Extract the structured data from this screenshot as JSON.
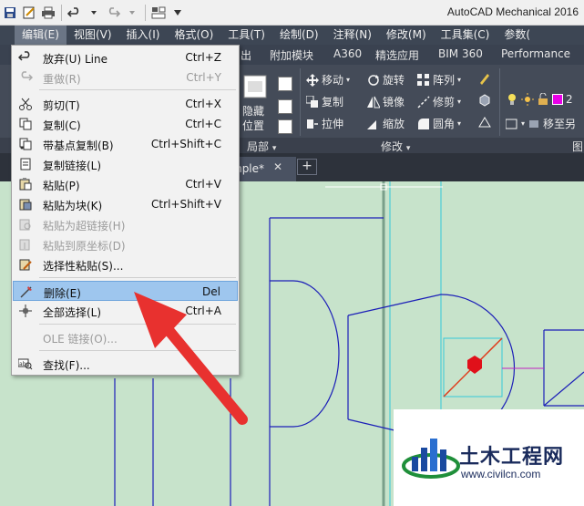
{
  "window": {
    "title": "AutoCAD Mechanical 2016"
  },
  "quick_access": {
    "icons": [
      "save-icon",
      "save-as-icon",
      "print-icon",
      "undo-icon",
      "redo-icon",
      "workspace-icon",
      "overflow-icon"
    ]
  },
  "menubar": {
    "items": [
      {
        "label": "编辑(E)",
        "active": true
      },
      {
        "label": "视图(V)"
      },
      {
        "label": "插入(I)"
      },
      {
        "label": "格式(O)"
      },
      {
        "label": "工具(T)"
      },
      {
        "label": "绘制(D)"
      },
      {
        "label": "注释(N)"
      },
      {
        "label": "修改(M)"
      },
      {
        "label": "工具集(C)"
      },
      {
        "label": "参数("
      }
    ]
  },
  "ribbon": {
    "tabs": [
      "出",
      "附加模块",
      "A360",
      "精选应用",
      "BIM 360",
      "Performance"
    ],
    "modify_tools": {
      "move": "移动",
      "rotate": "旋转",
      "array": "阵列",
      "copy": "复制",
      "mirror": "镜像",
      "trim": "修剪",
      "stretch": "拉伸",
      "scale": "缩放",
      "fillet": "圆角",
      "move_to_other": "移至另"
    },
    "local_tools": {
      "hide_label": "隐藏",
      "position_label": "位置"
    },
    "layer_value": "2",
    "panel_titles": {
      "local": "局部",
      "modify": "修改",
      "partial": "图"
    },
    "colors": {
      "layer_swatch": "#e800e8"
    }
  },
  "document": {
    "tab_label": "mple*",
    "close_glyph": "✕",
    "new_tab_glyph": "+"
  },
  "edit_menu": {
    "items": [
      {
        "icon": "undo-icon",
        "label": "放弃(U) Line",
        "shortcut": "Ctrl+Z",
        "disabled": false
      },
      {
        "icon": "redo-icon",
        "label": "重做(R)",
        "shortcut": "Ctrl+Y",
        "disabled": true
      },
      {
        "icon": "cut-icon",
        "label": "剪切(T)",
        "shortcut": "Ctrl+X",
        "disabled": false
      },
      {
        "icon": "copy-icon",
        "label": "复制(C)",
        "shortcut": "Ctrl+C",
        "disabled": false
      },
      {
        "icon": "copy-base-icon",
        "label": "带基点复制(B)",
        "shortcut": "Ctrl+Shift+C",
        "disabled": false
      },
      {
        "icon": "copy-link-icon",
        "label": "复制链接(L)",
        "shortcut": "",
        "disabled": false
      },
      {
        "icon": "paste-icon",
        "label": "粘贴(P)",
        "shortcut": "Ctrl+V",
        "disabled": false
      },
      {
        "icon": "paste-block-icon",
        "label": "粘贴为块(K)",
        "shortcut": "Ctrl+Shift+V",
        "disabled": false
      },
      {
        "icon": "paste-hyperlink-icon",
        "label": "粘贴为超链接(H)",
        "shortcut": "",
        "disabled": true
      },
      {
        "icon": "paste-orig-icon",
        "label": "粘贴到原坐标(D)",
        "shortcut": "",
        "disabled": true
      },
      {
        "icon": "paste-special-icon",
        "label": "选择性粘贴(S)...",
        "shortcut": "",
        "disabled": false
      },
      {
        "icon": "erase-icon",
        "label": "删除(E)",
        "shortcut": "Del",
        "disabled": false,
        "highlight": true
      },
      {
        "icon": "select-all-icon",
        "label": "全部选择(L)",
        "shortcut": "Ctrl+A",
        "disabled": false
      },
      {
        "icon": "",
        "label": "OLE 链接(O)...",
        "shortcut": "",
        "disabled": true
      },
      {
        "icon": "find-icon",
        "label": "查找(F)...",
        "shortcut": "",
        "disabled": false
      }
    ]
  },
  "watermark": {
    "name": "土木工程网",
    "url": "www.civilcn.com"
  },
  "annotation": {
    "arrow_color": "#e8312f"
  }
}
